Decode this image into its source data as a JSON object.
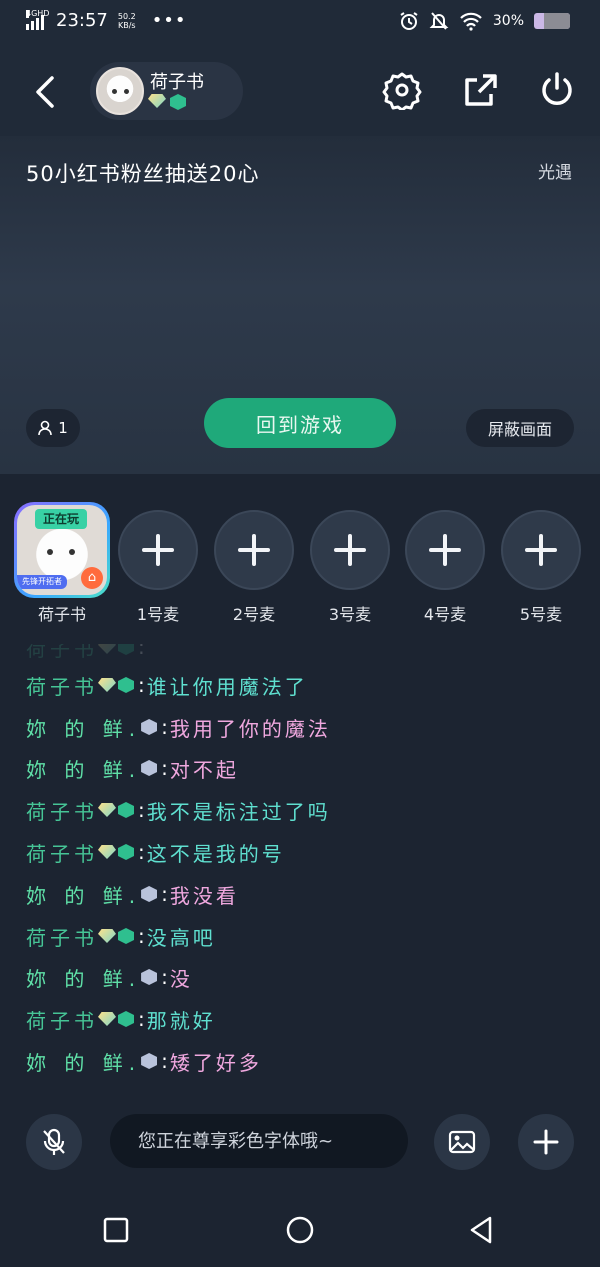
{
  "status_bar": {
    "network": "4GHD",
    "time": "23:57",
    "speed_value": "50.2",
    "speed_unit": "KB/s",
    "dots": "•••",
    "battery_text": "30%"
  },
  "header": {
    "host_name": "荷子书",
    "icons": [
      "back-icon",
      "gear-icon",
      "share-icon",
      "power-icon"
    ]
  },
  "room": {
    "title": "50小红书粉丝抽送20心",
    "game_name": "光遇",
    "viewer_count": "1",
    "return_button": "回到游戏",
    "mask_button": "屏蔽画面"
  },
  "seats": {
    "host": {
      "name": "荷子书",
      "status_tag": "正在玩",
      "bottom_tag": "先锋开拓者"
    },
    "mics": [
      "1号麦",
      "2号麦",
      "3号麦",
      "4号麦",
      "5号麦"
    ]
  },
  "chat": {
    "messages": [
      {
        "user": "荷子书",
        "type": "a",
        "text": ""
      },
      {
        "user": "荷子书",
        "type": "a",
        "text": "谁让你用魔法了"
      },
      {
        "user": "妳 的 鲜.",
        "type": "b",
        "text": "我用了你的魔法"
      },
      {
        "user": "妳 的 鲜.",
        "type": "b",
        "text": "对不起"
      },
      {
        "user": "荷子书",
        "type": "a",
        "text": "我不是标注过了吗"
      },
      {
        "user": "荷子书",
        "type": "a",
        "text": "这不是我的号"
      },
      {
        "user": "妳 的 鲜.",
        "type": "b",
        "text": "我没看"
      },
      {
        "user": "荷子书",
        "type": "a",
        "text": "没高吧"
      },
      {
        "user": "妳 的 鲜.",
        "type": "b",
        "text": "没"
      },
      {
        "user": "荷子书",
        "type": "a",
        "text": "那就好"
      },
      {
        "user": "妳 的 鲜.",
        "type": "b",
        "text": "矮了好多"
      }
    ]
  },
  "input": {
    "placeholder": "您正在尊享彩色字体哦~"
  },
  "colors": {
    "accent_green": "#1fa97a",
    "name_green": "#46c596",
    "text_pink": "#f0a8df",
    "text_teal": "#5fe0d0"
  }
}
